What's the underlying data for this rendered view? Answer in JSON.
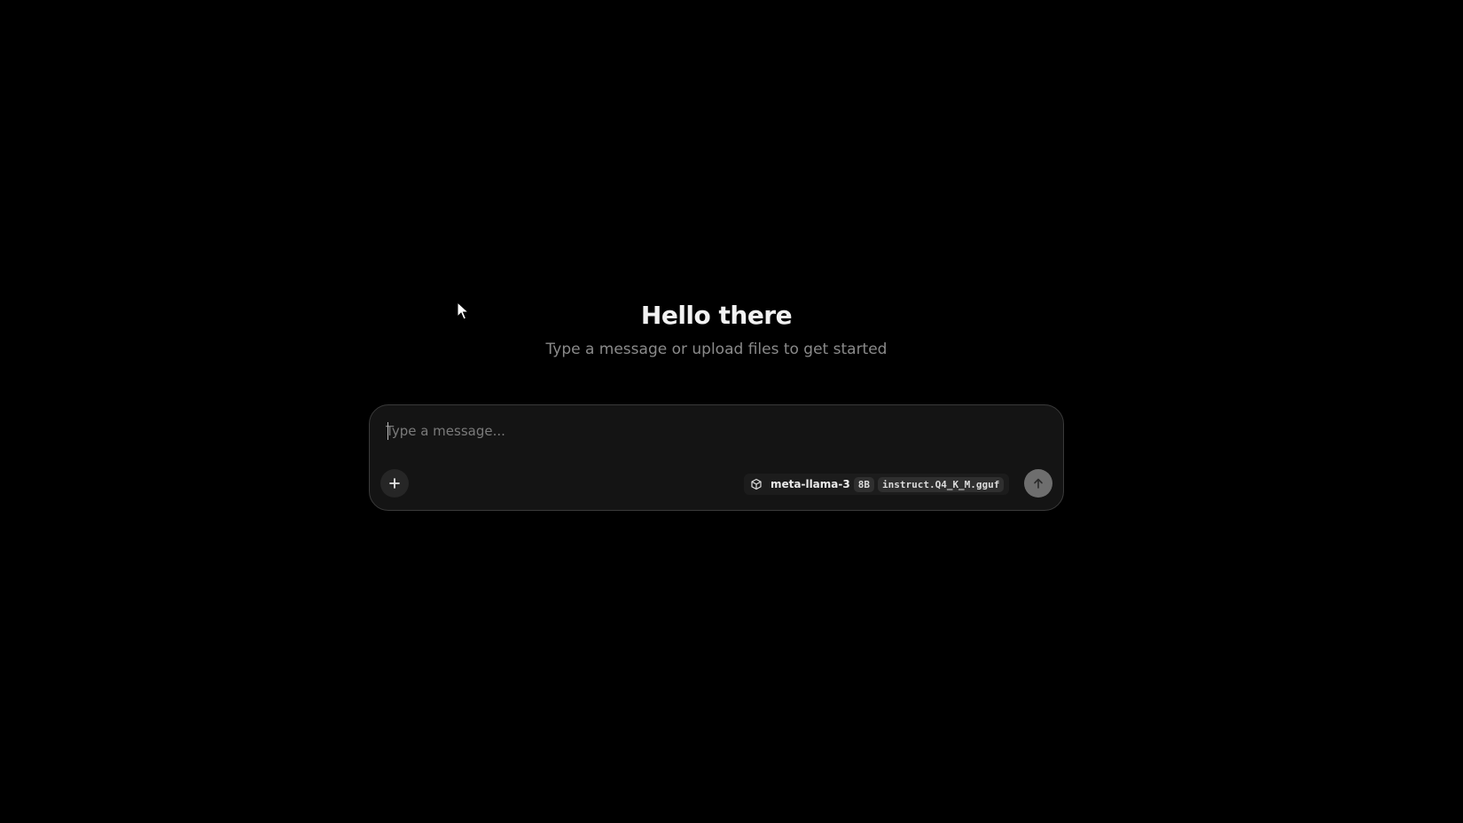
{
  "welcome": {
    "title": "Hello there",
    "subtitle": "Type a message or upload files to get started"
  },
  "composer": {
    "placeholder": "Type a message...",
    "value": "",
    "attach_icon": "plus-icon",
    "send_icon": "arrow-up-icon",
    "model": {
      "icon": "cube-icon",
      "name": "meta-llama-3",
      "size_badge": "8B",
      "file_badge": "instruct.Q4_K_M.gguf"
    }
  },
  "colors": {
    "background": "#000000",
    "composer_bg": "#141414",
    "composer_border": "#3a3a3a",
    "send_button": "#6e6e6e"
  }
}
